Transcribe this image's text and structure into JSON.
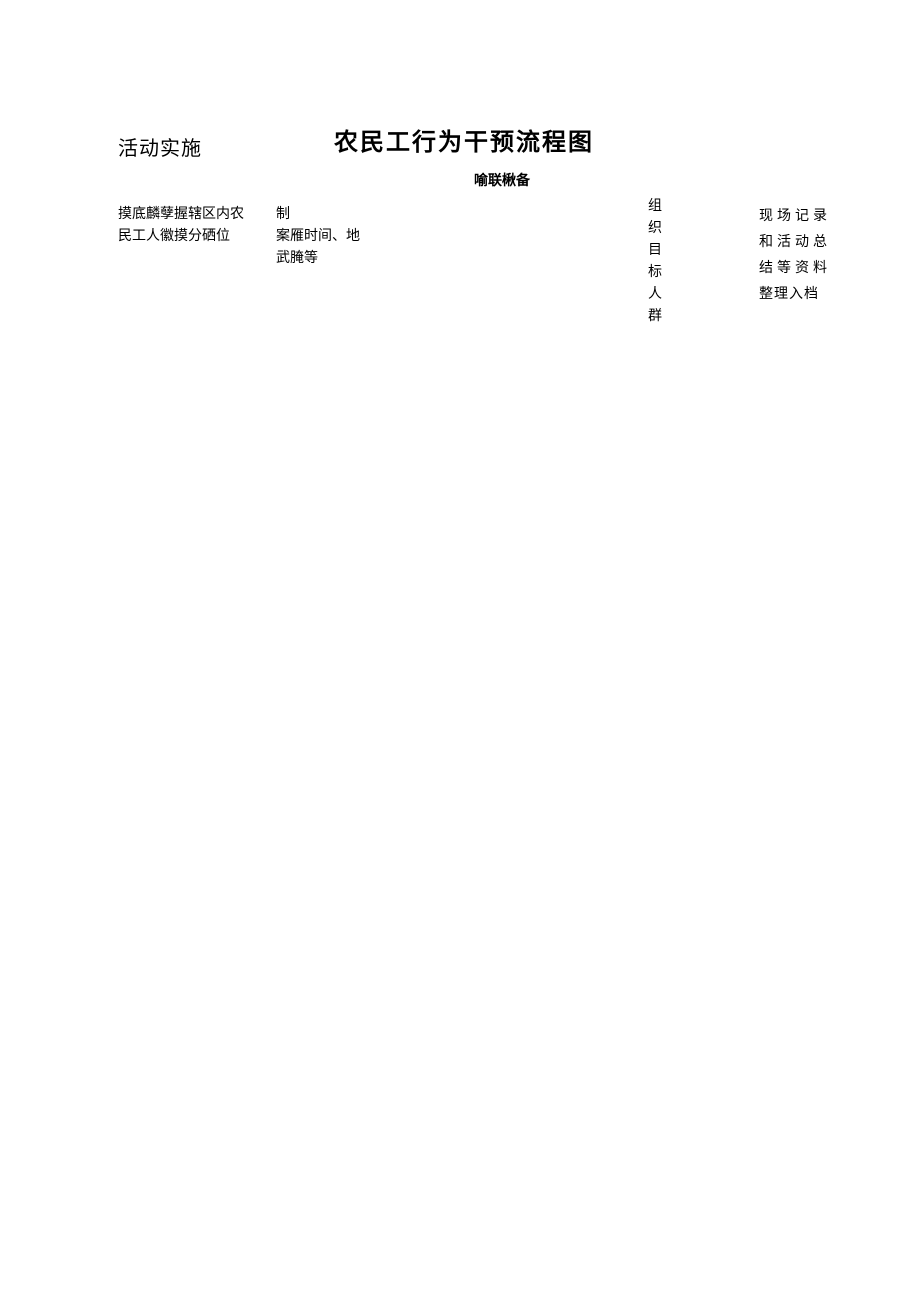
{
  "header": {
    "activity_label": "活动实施",
    "main_title": "农民工行为干预流程图",
    "subtitle": "喻联楸备"
  },
  "columns": {
    "col1": {
      "line1": "摸底麟孽握辖区内农",
      "line2": "民工人徽摸分硒位"
    },
    "col2": {
      "line1": "制",
      "line2": "案雁时间、地",
      "line3": "武腌等"
    },
    "col3": {
      "c1": "组",
      "c2": "织",
      "c3": "目",
      "c4": "标",
      "c5": "人",
      "c6": "群"
    },
    "col4": {
      "line1": "现场记录",
      "line2": "和活动总",
      "line3": "结等资料",
      "line4": "整理入档"
    }
  }
}
